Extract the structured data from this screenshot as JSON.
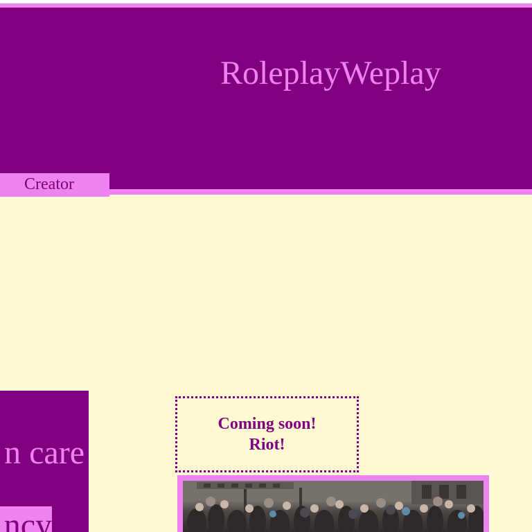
{
  "header": {
    "site_title": "RoleplayWeplay",
    "nav_tabs": [
      {
        "label": "Creator"
      }
    ]
  },
  "left_panel": {
    "heading_fragment": "n care",
    "subheading_fragment": "ncy"
  },
  "announcement": {
    "line1": "Coming soon!",
    "line2": "Riot!"
  },
  "colors": {
    "page_background": "#fffad4",
    "header_purple": "#800080",
    "violet_accent": "#ee82ee"
  },
  "icons": {
    "riot_photo": "crowd-photo"
  }
}
